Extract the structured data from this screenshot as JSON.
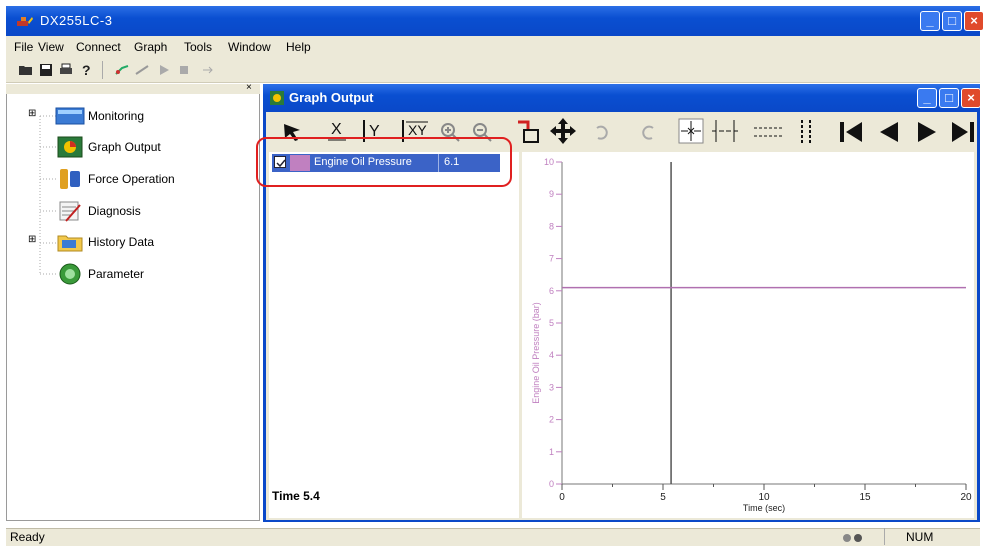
{
  "window": {
    "title": "DX255LC-3",
    "buttons": [
      "minimize",
      "maximize",
      "close"
    ]
  },
  "menu": [
    "File",
    "View",
    "Connect",
    "Graph",
    "Tools",
    "Window",
    "Help"
  ],
  "tree": [
    {
      "label": "Monitoring",
      "expander": "⊞",
      "icon": "monitor-icon"
    },
    {
      "label": "Graph Output",
      "expander": "",
      "icon": "graph-icon"
    },
    {
      "label": "Force Operation",
      "expander": "",
      "icon": "tools-icon"
    },
    {
      "label": "Diagnosis",
      "expander": "",
      "icon": "diagnosis-icon"
    },
    {
      "label": "History Data",
      "expander": "⊞",
      "icon": "folder-icon"
    },
    {
      "label": "Parameter",
      "expander": "",
      "icon": "parameter-icon"
    }
  ],
  "graph_window": {
    "title": "Graph Output",
    "series_row": {
      "name": "Engine Oil Pressure",
      "value": "6.1",
      "checked": true,
      "color": "#c080c0"
    },
    "time_label": "Time 5.4"
  },
  "statusbar": {
    "status": "Ready",
    "num": "NUM"
  },
  "colors": {
    "titlebar": "#0a48c8",
    "series_line": "#b070b0",
    "highlight_box": "#e02020"
  },
  "chart_data": {
    "type": "line",
    "ylabel": "Engine Oil Pressure (bar)",
    "xlabel": "Time (sec)",
    "ylim": [
      0,
      10
    ],
    "xlim": [
      0,
      20
    ],
    "yticks": [
      "0",
      "1",
      "2",
      "3",
      "4",
      "5",
      "6",
      "7",
      "8",
      "9",
      "10"
    ],
    "xticks": [
      "0",
      "5",
      "10",
      "15",
      "20"
    ],
    "series": [
      {
        "name": "Engine Oil Pressure",
        "x": [
          0,
          6.5,
          20
        ],
        "y": [
          6.1,
          6.1,
          6.1
        ]
      }
    ],
    "cursor_x": 5.4
  }
}
